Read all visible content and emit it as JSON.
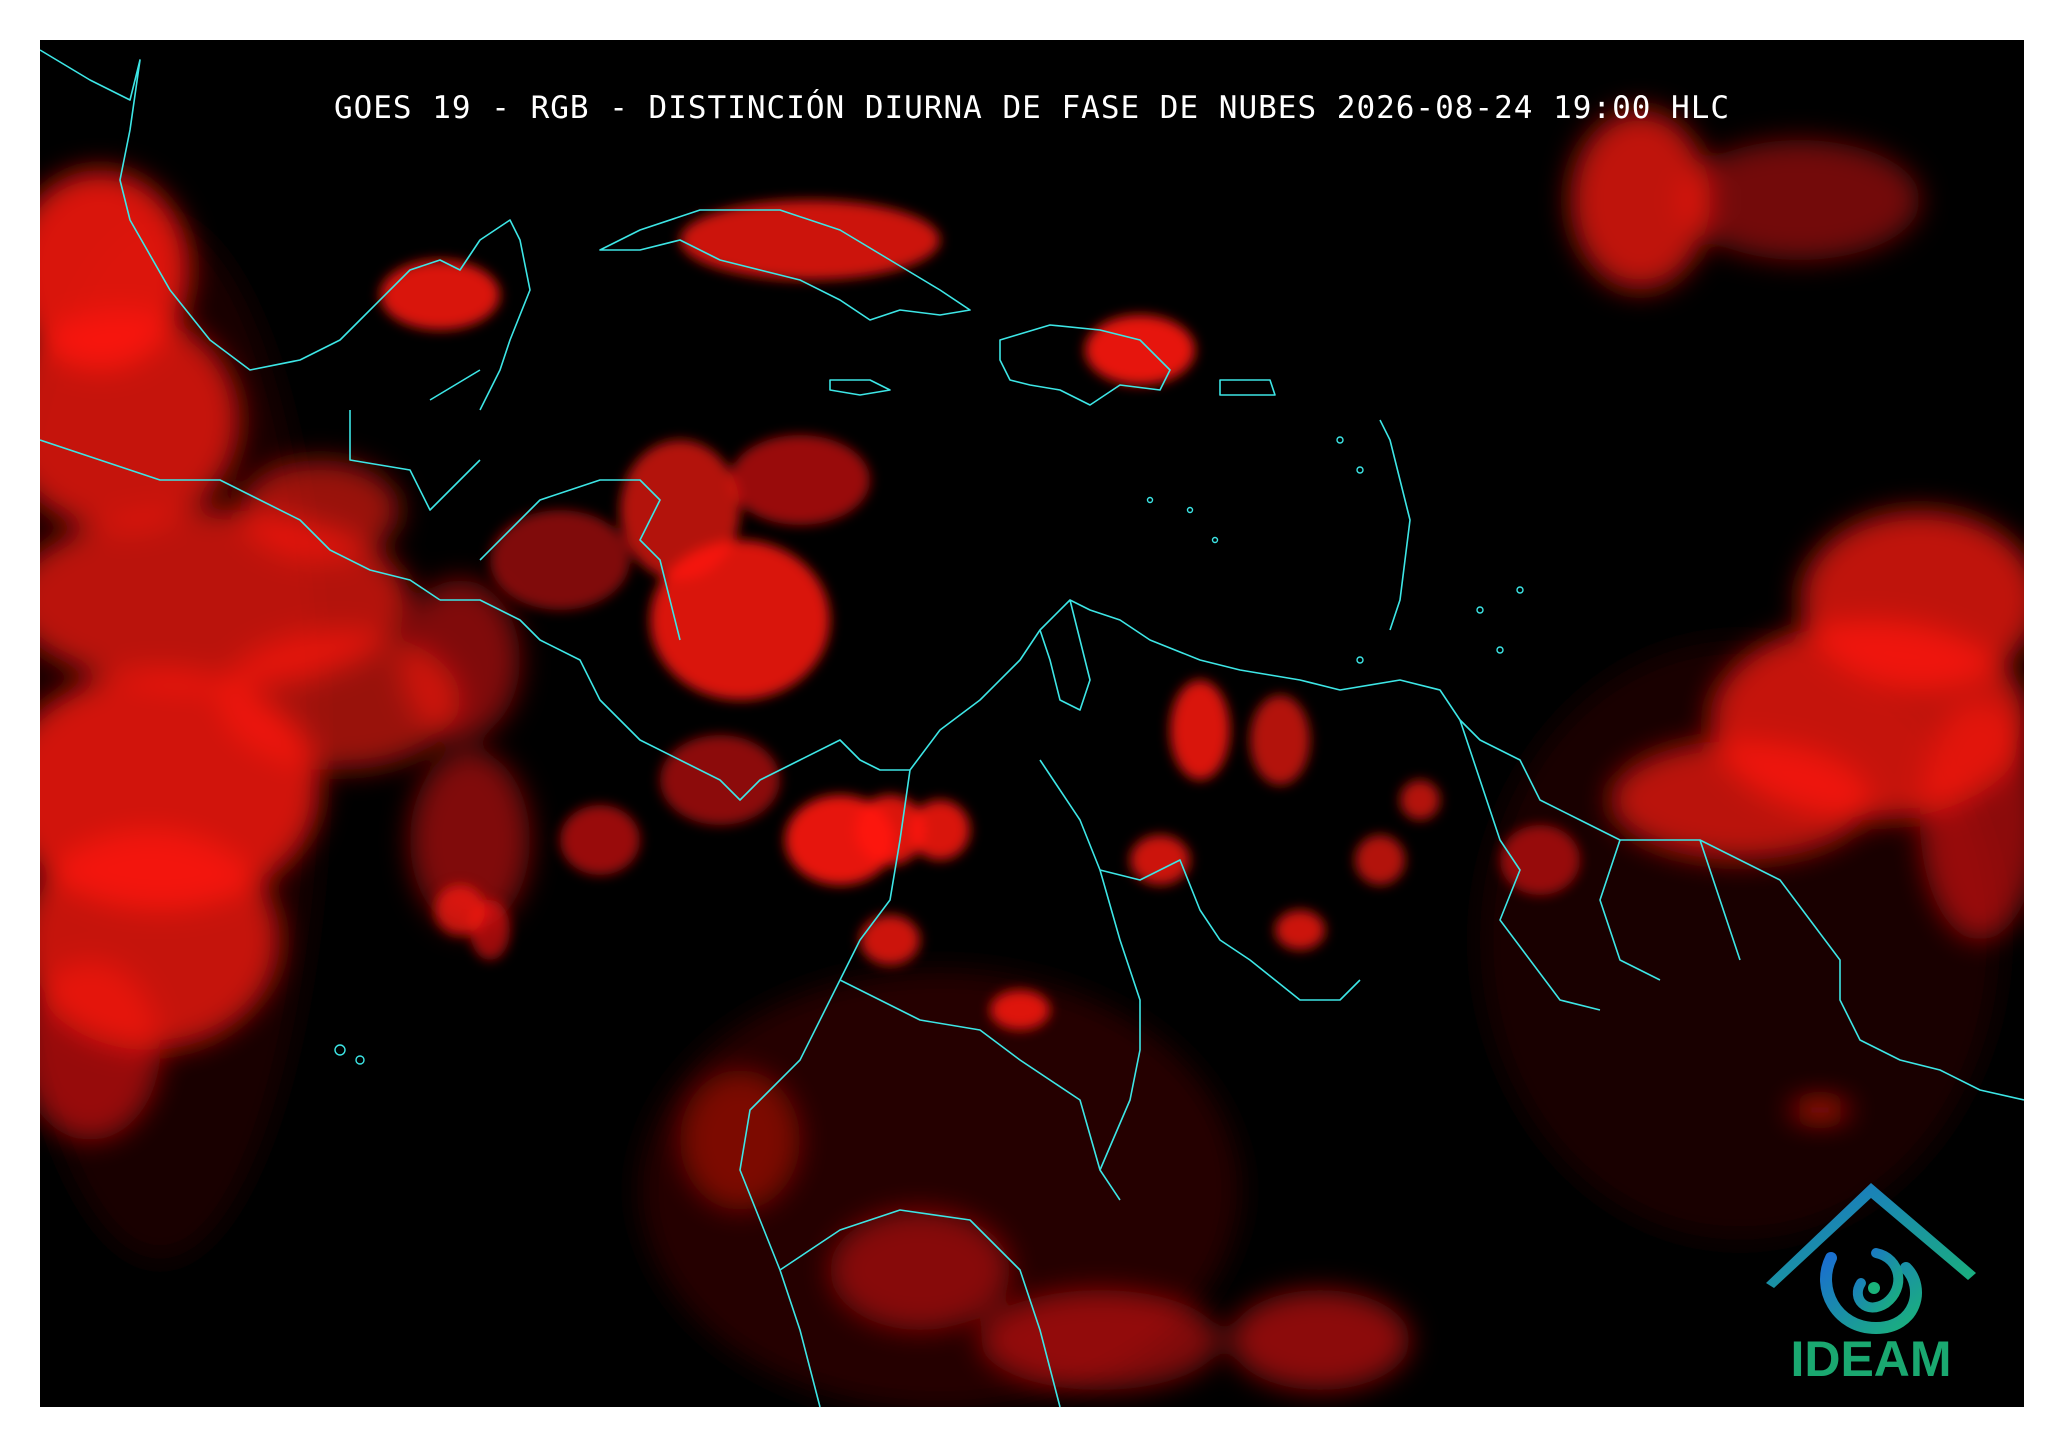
{
  "title": "GOES 19 - RGB - DISTINCIÓN DIURNA DE FASE DE NUBES 2026-08-24 19:00 HLC",
  "logo": {
    "text": "IDEAM",
    "color": "#1aa870"
  },
  "colors": {
    "background": "#000000",
    "clouds": "#ff1010",
    "coastlines": "#3de6e6",
    "frame": "#ffffff"
  }
}
